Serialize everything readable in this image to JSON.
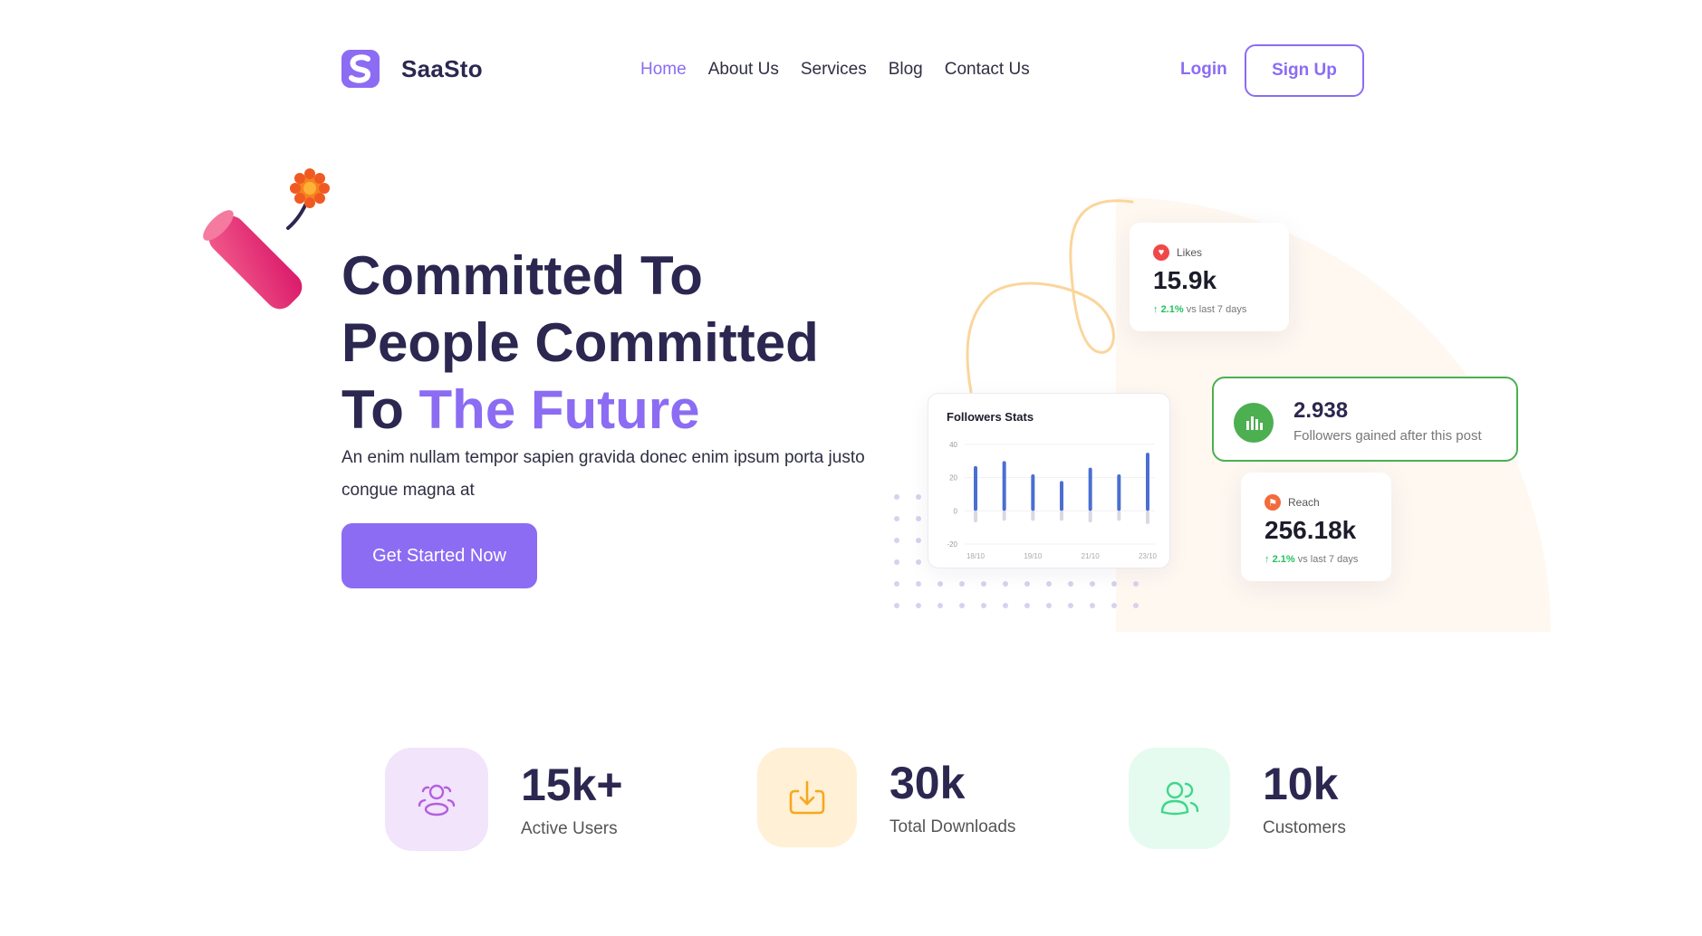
{
  "brand": {
    "name": "SaaSto",
    "letter": "S"
  },
  "nav": {
    "items": [
      {
        "label": "Home",
        "active": true
      },
      {
        "label": "About Us",
        "active": false
      },
      {
        "label": "Services",
        "active": false
      },
      {
        "label": "Blog",
        "active": false
      },
      {
        "label": "Contact Us",
        "active": false
      }
    ],
    "login": "Login",
    "signup": "Sign Up"
  },
  "hero": {
    "title_line1": "Committed To",
    "title_line2": "People Committed",
    "title_line3_plain": "To ",
    "title_line3_accent": "The Future",
    "description": "An enim nullam tempor sapien gravida donec enim ipsum porta justo congue magna at",
    "cta": "Get Started Now"
  },
  "cards": {
    "likes": {
      "label": "Likes",
      "value": "15.9k",
      "change": "2.1%",
      "change_text": "vs last 7 days"
    },
    "reach": {
      "label": "Reach",
      "value": "256.18k",
      "change": "2.1%",
      "change_text": "vs last 7 days"
    },
    "gained": {
      "value": "2.938",
      "label": "Followers gained after this post"
    },
    "followers": {
      "title": "Followers Stats"
    }
  },
  "chart_data": {
    "type": "bar",
    "title": "Followers Stats",
    "yticks": [
      "40",
      "20",
      "0",
      "-20"
    ],
    "ylim": [
      -20,
      40
    ],
    "xticks": [
      "18/10",
      "19/10",
      "21/10",
      "23/10"
    ],
    "values": [
      27,
      30,
      22,
      18,
      26,
      22,
      35
    ],
    "negative_values": [
      -7,
      -6,
      -6,
      -6,
      -7,
      -6,
      -8
    ]
  },
  "stats": [
    {
      "value": "15k+",
      "label": "Active Users",
      "icon": "users-icon"
    },
    {
      "value": "30k",
      "label": "Total Downloads",
      "icon": "download-icon"
    },
    {
      "value": "10k",
      "label": "Customers",
      "icon": "customers-icon"
    }
  ],
  "colors": {
    "primary": "#8b6cf3",
    "dark": "#2b2750",
    "green": "#4caf50",
    "bar": "#4a6fd1"
  }
}
